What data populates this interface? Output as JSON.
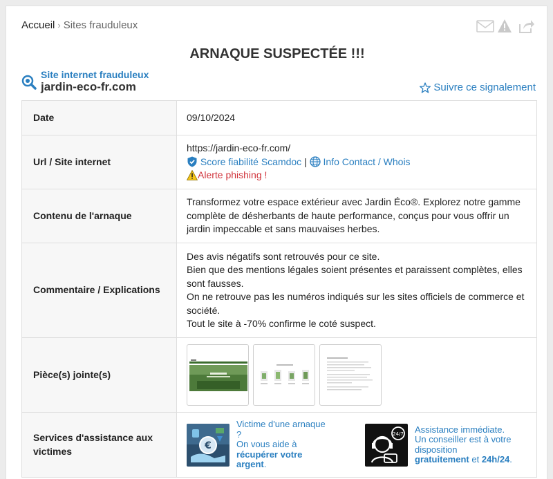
{
  "breadcrumb": {
    "home": "Accueil",
    "separator": "›",
    "current": "Sites frauduleux"
  },
  "page_title": "ARNAQUE SUSPECTÉE !!!",
  "site": {
    "kind": "Site internet frauduleux",
    "name": "jardin-eco-fr.com"
  },
  "follow_label": "Suivre ce signalement",
  "icons": {
    "email": "envelope-icon",
    "report": "warning-icon",
    "share": "share-icon",
    "follow": "star-outline-icon",
    "site": "magnifier-icon"
  },
  "table": {
    "date": {
      "label": "Date",
      "value": "09/10/2024"
    },
    "url": {
      "label": "Url / Site internet",
      "value": "https://jardin-eco-fr.com/",
      "score_link": "Score fiabilité Scamdoc",
      "divider": "|",
      "whois_link": "Info Contact / Whois",
      "alert": "Alerte phishing !"
    },
    "content": {
      "label": "Contenu de l'arnaque",
      "lines": [
        "Transformez votre espace extérieur avec Jardin Éco®. Explorez notre gamme",
        "complète de désherbants de haute performance, conçus pour vous offrir un",
        "jardin impeccable et sans mauvaises herbes."
      ]
    },
    "comment": {
      "label": "Commentaire / Explications",
      "lines": [
        "Des avis négatifs sont retrouvés pour ce site.",
        "Bien que des mentions légales soient présentes et paraissent complètes, elles",
        "sont fausses.",
        "On ne retrouve pas les numéros indiqués sur les sites officiels de commerce et",
        "société.",
        "Tout le site à -70% confirme le coté suspect."
      ]
    },
    "attachments": {
      "label": "Pièce(s) jointe(s)",
      "count": 3
    },
    "services": {
      "label_line1": "Services d'assistance aux",
      "label_line2": "victimes",
      "victim": {
        "line1": "Victime d'une arnaque ?",
        "line2": "On vous aide à",
        "bold": "récupérer votre argent",
        "end": "."
      },
      "assist": {
        "line1": "Assistance immédiate.",
        "line2": "Un conseiller est à votre",
        "line3": "disposition",
        "bold1": "gratuitement",
        "mid": " et ",
        "bold2": "24h/24",
        "end": "."
      }
    }
  },
  "colors": {
    "link": "#2a7fc0",
    "alert": "#d0333b",
    "label_bg": "#f7f7f7"
  }
}
